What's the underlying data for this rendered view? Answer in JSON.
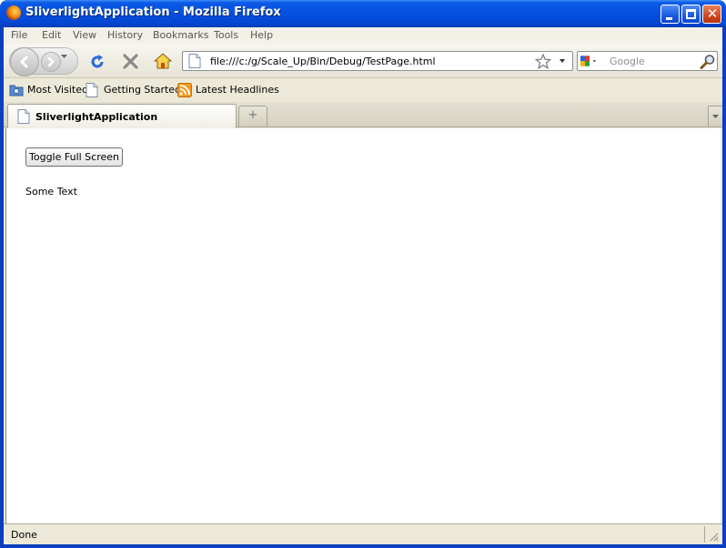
{
  "window": {
    "title": "SliverlightApplication - Mozilla Firefox"
  },
  "menu": [
    "File",
    "Edit",
    "View",
    "History",
    "Bookmarks",
    "Tools",
    "Help"
  ],
  "navigation": {
    "url": "file:///c:/g/Scale_Up/Bin/Debug/TestPage.html",
    "search_placeholder": "Google"
  },
  "bookmarks": [
    "Most Visited",
    "Getting Started",
    "Latest Headlines"
  ],
  "tabs": [
    {
      "label": "SliverlightApplication",
      "active": true
    }
  ],
  "page": {
    "toggle_button": "Toggle Full Screen",
    "text": "Some Text"
  },
  "status": "Done",
  "colors": {
    "titlebar": "#0550e0",
    "chrome": "#ece9d8",
    "close_button": "#d0461f"
  }
}
